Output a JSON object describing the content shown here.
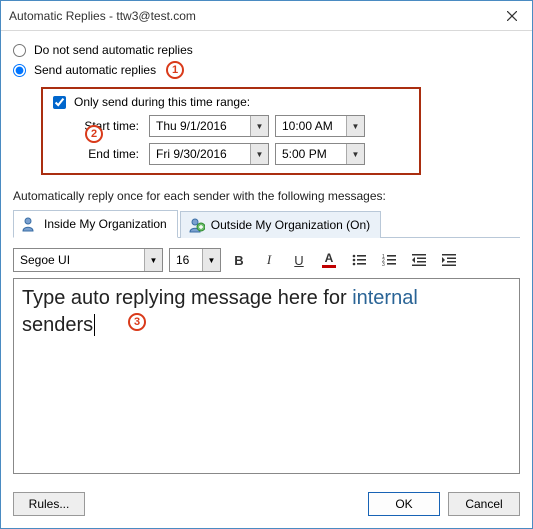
{
  "window": {
    "title": "Automatic Replies - ttw3@test.com"
  },
  "radio": {
    "dont_send_label": "Do not send automatic replies",
    "send_label": "Send automatic replies"
  },
  "callouts": {
    "one": "1",
    "two": "2",
    "three": "3"
  },
  "timerange": {
    "checkbox_label": "Only send during this time range:",
    "start_label": "Start time:",
    "end_label": "End time:",
    "start_date": "Thu 9/1/2016",
    "start_time": "10:00 AM",
    "end_date": "Fri 9/30/2016",
    "end_time": "5:00 PM"
  },
  "description": "Automatically reply once for each sender with the following messages:",
  "tabs": {
    "inside": "Inside My Organization",
    "outside": "Outside My Organization (On)"
  },
  "toolbar": {
    "font_name": "Segoe UI",
    "font_size": "16",
    "bold": "B",
    "italic": "I",
    "underline": "U",
    "fontcolor_a": "A"
  },
  "editor": {
    "line1a": "Type auto replying message here for ",
    "line1_link": "internal",
    "line2": "senders"
  },
  "footer": {
    "rules": "Rules...",
    "ok": "OK",
    "cancel": "Cancel"
  }
}
